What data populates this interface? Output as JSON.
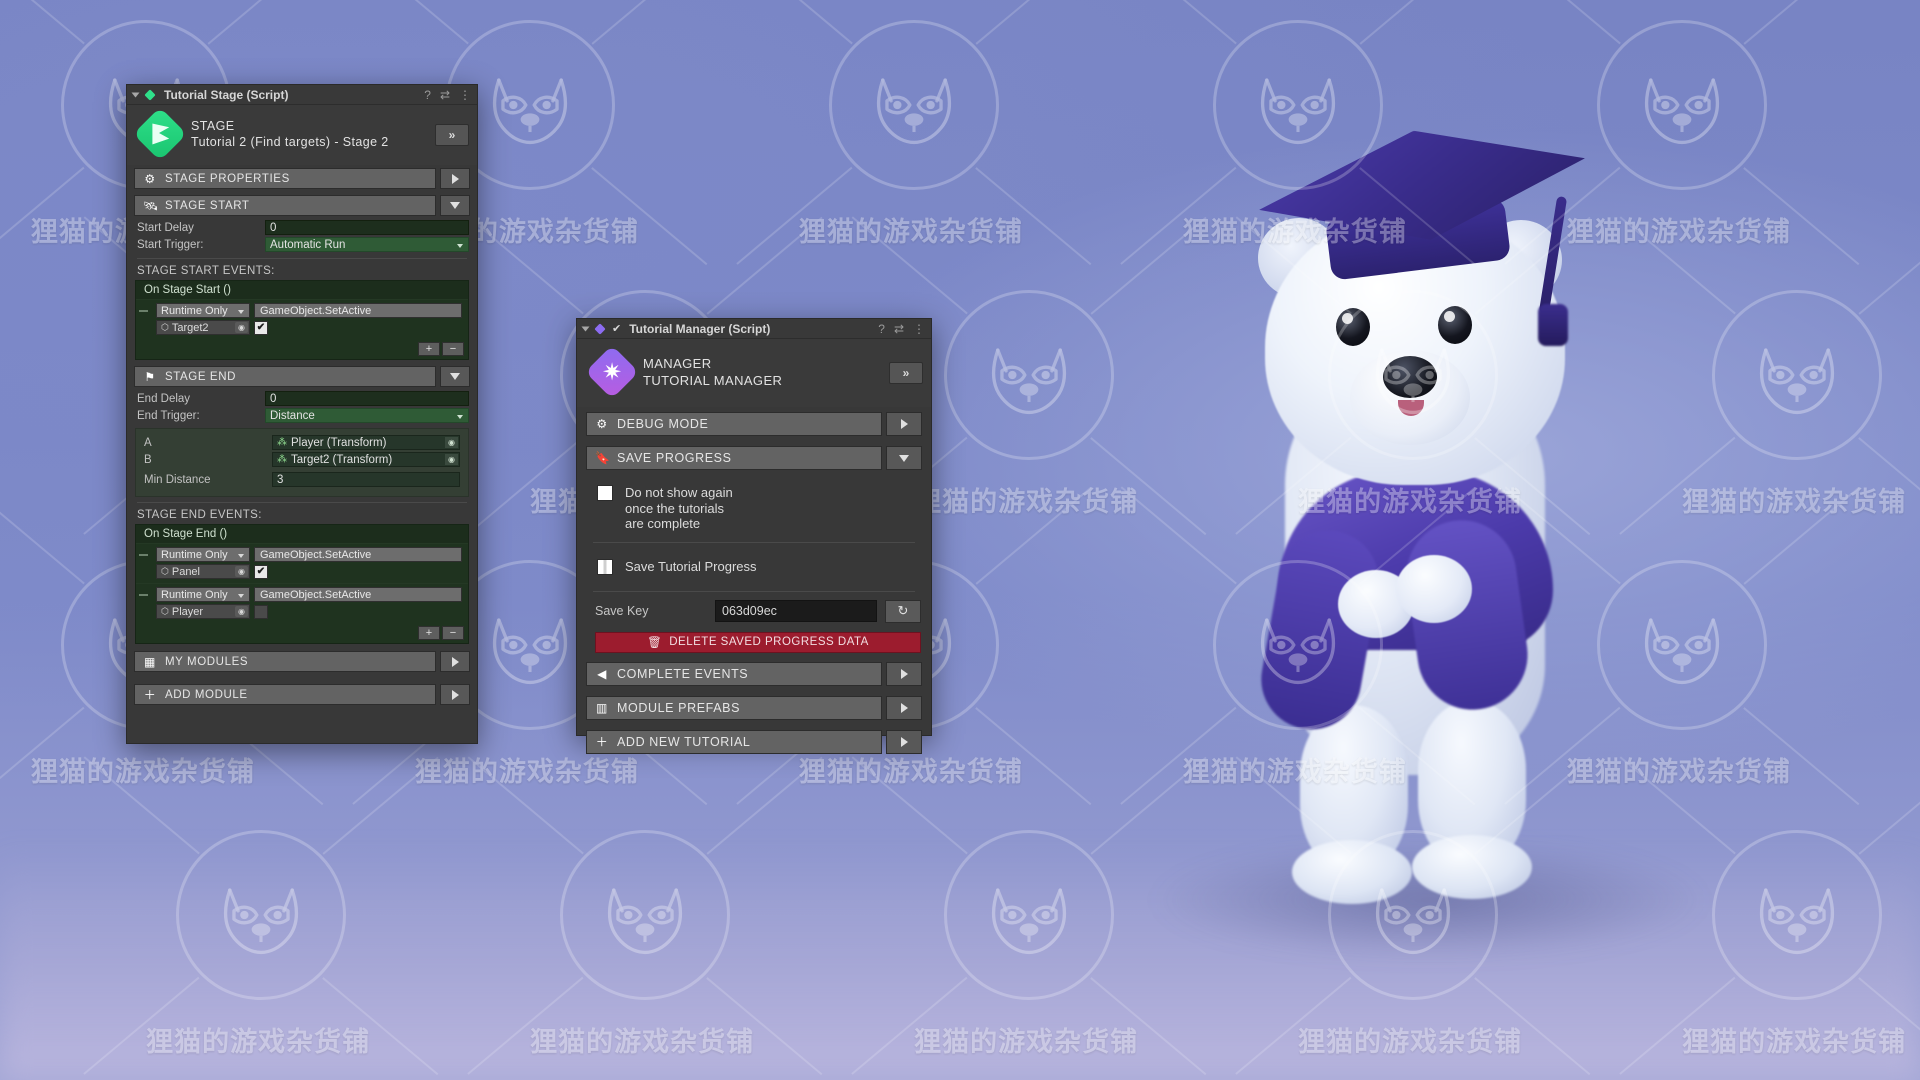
{
  "stage_panel": {
    "header": {
      "title": "Tutorial Stage (Script)",
      "help_icon": "help-icon",
      "preset_icon": "preset-icon",
      "menu_icon": "kebab-menu-icon"
    },
    "banner": {
      "line1": "STAGE",
      "line2": "Tutorial 2 (Find targets) - Stage 2",
      "expand_label": "»",
      "icon": "stage-flag-icon"
    },
    "sections": [
      {
        "label": "STAGE PROPERTIES",
        "icon": "gear-icon",
        "button": "tri-right"
      },
      {
        "label": "STAGE START",
        "icon": "rocket-icon",
        "button": "tri-down"
      }
    ],
    "start_fields": [
      {
        "label": "Start Delay",
        "value": "0",
        "kind": "number"
      },
      {
        "label": "Start Trigger:",
        "value": "Automatic Run",
        "kind": "popup"
      }
    ],
    "start_events_label": "STAGE START EVENTS:",
    "start_event": {
      "title": "On Stage Start ()",
      "items": [
        {
          "mode": "Runtime Only",
          "method": "GameObject.SetActive",
          "target": "Target2",
          "checked": true
        }
      ],
      "add_label": "+",
      "remove_label": "−"
    },
    "stage_end_section": {
      "label": "STAGE END",
      "icon": "flag-icon",
      "button": "tri-down"
    },
    "end_fields": [
      {
        "label": "End Delay",
        "value": "0",
        "kind": "number"
      },
      {
        "label": "End Trigger:",
        "value": "Distance",
        "kind": "popup"
      }
    ],
    "distance_box": [
      {
        "label": "A",
        "value": "Player (Transform)",
        "kind": "object"
      },
      {
        "label": "B",
        "value": "Target2 (Transform)",
        "kind": "object"
      },
      {
        "label": "Min Distance",
        "value": "3",
        "kind": "number"
      }
    ],
    "end_events_label": "STAGE END EVENTS:",
    "end_event": {
      "title": "On Stage End ()",
      "items": [
        {
          "mode": "Runtime Only",
          "method": "GameObject.SetActive",
          "target": "Panel",
          "checked": true
        },
        {
          "mode": "Runtime Only",
          "method": "GameObject.SetActive",
          "target": "Player",
          "checked": false
        }
      ],
      "add_label": "+",
      "remove_label": "−"
    },
    "footer_sections": [
      {
        "label": "MY MODULES",
        "icon": "modules-icon",
        "button": "tri-right"
      },
      {
        "label": "ADD MODULE",
        "icon": "plus-icon",
        "button": "tri-right"
      }
    ]
  },
  "manager_panel": {
    "header": {
      "title": "Tutorial Manager (Script)",
      "help_icon": "help-icon",
      "preset_icon": "preset-icon",
      "menu_icon": "kebab-menu-icon",
      "enabled": true
    },
    "banner": {
      "line1": "MANAGER",
      "line2": "TUTORIAL MANAGER",
      "expand_label": "»",
      "icon": "manager-burst-icon"
    },
    "sections": [
      {
        "label": "DEBUG MODE",
        "icon": "gear-icon",
        "button": "tri-right"
      },
      {
        "label": "SAVE PROGRESS",
        "icon": "bookmark-icon",
        "button": "tri-down"
      }
    ],
    "checkboxes": [
      {
        "lines": [
          "Do not show again",
          "once the tutorials",
          "are complete"
        ],
        "checked": false,
        "style": "plain"
      },
      {
        "lines": [
          "Save Tutorial Progress"
        ],
        "checked": false,
        "style": "mixed"
      }
    ],
    "save_key": {
      "label": "Save Key",
      "value": "063d09ec",
      "placeholder": "Save Key",
      "refresh_icon": "refresh-icon"
    },
    "delete_button": {
      "label": "DELETE SAVED PROGRESS DATA",
      "icon": "trash-icon"
    },
    "footer_sections": [
      {
        "label": "COMPLETE EVENTS",
        "icon": "chevron-left-icon",
        "button": "tri-right"
      },
      {
        "label": "MODULE PREFABS",
        "icon": "prefab-icon",
        "button": "tri-right"
      },
      {
        "label": "ADD NEW TUTORIAL",
        "icon": "plus-icon",
        "button": "tri-right"
      }
    ]
  },
  "watermark": {
    "text": "狸猫的游戏杂货铺",
    "logo_name": "raccoon-logo-watermark"
  },
  "colors": {
    "panel_bg": "#383838",
    "section_bar": "#636363",
    "event_green": "#1f331f",
    "popup_green": "#2f5b36",
    "danger_red": "#9c1c2e",
    "stage_icon": "#2fe08a",
    "manager_icon": "#8c6cf2",
    "background": "#7b87c6"
  }
}
